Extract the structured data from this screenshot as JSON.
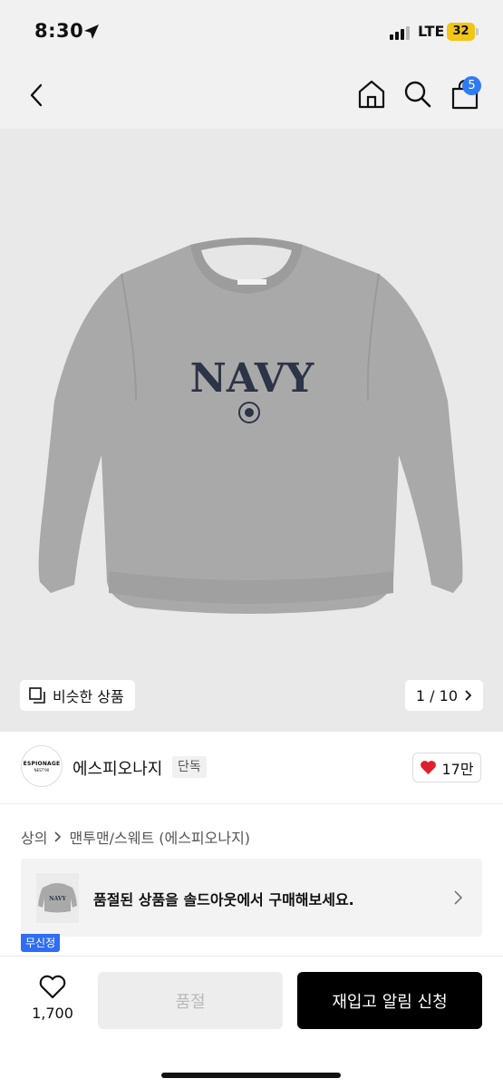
{
  "status_bar": {
    "time": "8:30",
    "network": "LTE",
    "battery": "32"
  },
  "header": {
    "cart_count": "5",
    "icons": [
      "back-icon",
      "home-icon",
      "search-icon",
      "cart-icon"
    ]
  },
  "product_image": {
    "print_text": "NAVY",
    "similar_label": "비슷한 상품",
    "page_indicator": "1 / 10",
    "colors": {
      "background": "#e9e9e9",
      "sweatshirt": "#a9a9a9",
      "print": "#2d3447"
    }
  },
  "brand": {
    "logo_line1": "ESPIONAGE",
    "logo_line2": "NEST'90",
    "name": "에스피오나지",
    "badge": "단독",
    "likes": "17만"
  },
  "breadcrumb": {
    "items": [
      "상의",
      "맨투맨/스웨트 (에스피오나지)"
    ]
  },
  "soldout_banner": {
    "text": "품절된 상품을 솔드아웃에서 구매해보세요.",
    "thumb_text": "NAVY",
    "coupon_tag": "무신정"
  },
  "bottom_bar": {
    "wish_count": "1,700",
    "soldout_label": "품절",
    "restock_label": "재입고 알림 신청"
  },
  "colors": {
    "accent_blue": "#2f7bf6",
    "heart_red": "#e0202a",
    "primary_button": "#000000"
  }
}
